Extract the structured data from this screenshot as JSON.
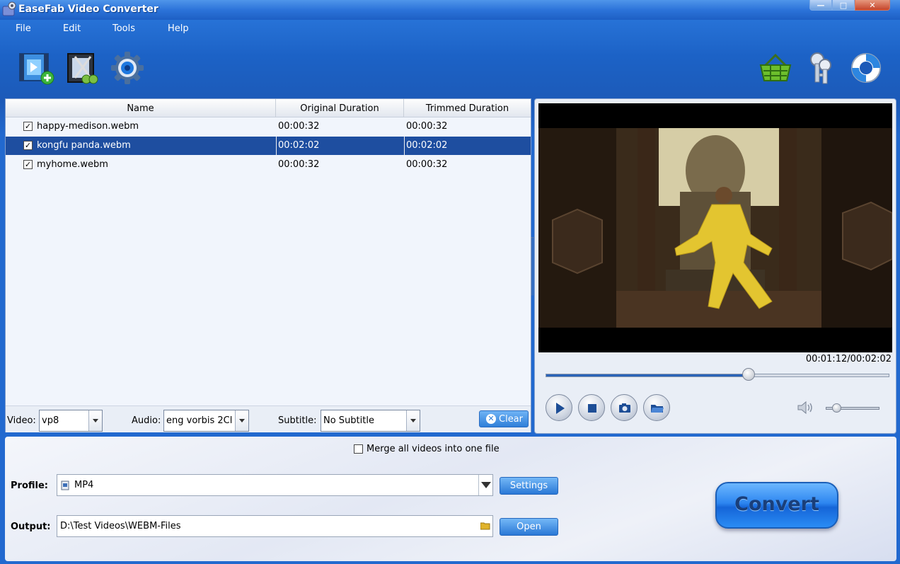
{
  "window": {
    "title": "EaseFab Video Converter",
    "controls": {
      "minimize": "—",
      "maximize": "□",
      "close": "✕"
    }
  },
  "menu": [
    "File",
    "Edit",
    "Tools",
    "Help"
  ],
  "toolbar": {
    "left": [
      "add-video-icon",
      "edit-video-icon",
      "settings-gear-icon"
    ],
    "right": [
      "shopping-basket-icon",
      "register-keys-icon",
      "help-lifebuoy-icon"
    ]
  },
  "file_list": {
    "columns": [
      "Name",
      "Original Duration",
      "Trimmed Duration"
    ],
    "rows": [
      {
        "checked": true,
        "name": "happy-medison.webm",
        "original": "00:00:32",
        "trimmed": "00:00:32",
        "selected": false
      },
      {
        "checked": true,
        "name": "kongfu panda.webm",
        "original": "00:02:02",
        "trimmed": "00:02:02",
        "selected": true
      },
      {
        "checked": true,
        "name": "myhome.webm",
        "original": "00:00:32",
        "trimmed": "00:00:32",
        "selected": false
      }
    ],
    "checkmark": "✓"
  },
  "track_selectors": {
    "video_label": "Video:",
    "video_value": "vp8",
    "audio_label": "Audio:",
    "audio_value": "eng vorbis 2Cl",
    "subtitle_label": "Subtitle:",
    "subtitle_value": "No Subtitle",
    "clear_label": "Clear",
    "clear_icon": "✕"
  },
  "preview": {
    "time": "00:01:12/00:02:02",
    "progress": 0.59,
    "volume": 0.2,
    "controls": [
      "play-icon",
      "stop-icon",
      "snapshot-camera-icon",
      "open-folder-icon"
    ]
  },
  "bottom": {
    "merge_label": "Merge all videos into one file",
    "merge_checked": false,
    "profile_label": "Profile:",
    "profile_value": "MP4",
    "settings_label": "Settings",
    "output_label": "Output:",
    "output_value": "D:\\Test Videos\\WEBM-Files",
    "open_label": "Open",
    "convert_label": "Convert"
  },
  "colors": {
    "accent": "#1e4ea0",
    "frame_blue": "#1c5ab8",
    "button_blue": "#2f7fd9"
  }
}
